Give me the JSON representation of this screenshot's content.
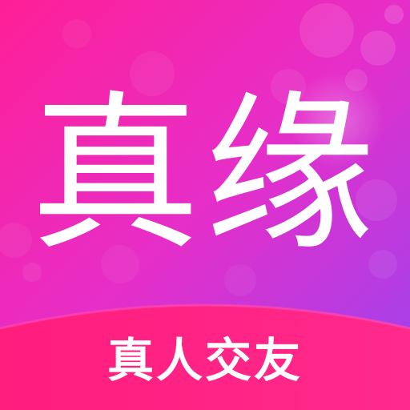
{
  "app": {
    "logo_text": "真缘",
    "slogan": "真人交友"
  },
  "colors": {
    "gradient_start": "#ff1f96",
    "gradient_mid": "#e62ec9",
    "gradient_end": "#9a44f0",
    "banner": "#ff1d7e",
    "banner_edge": "#ff3fb4",
    "text": "#ffffff"
  },
  "icons": {
    "background": "bokeh-background",
    "banner": "curved-banner-shape"
  }
}
